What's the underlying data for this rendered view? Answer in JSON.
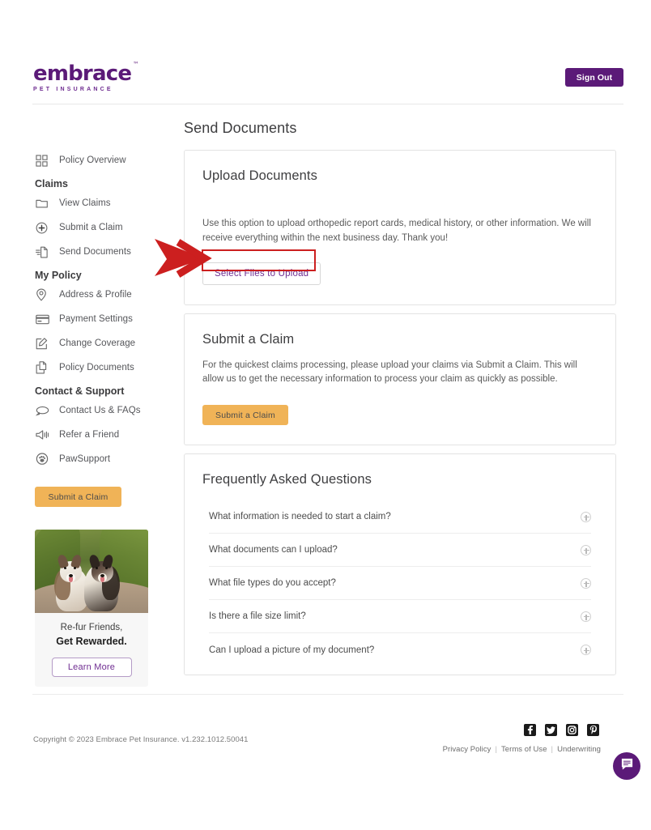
{
  "header": {
    "brand_word": "embrace",
    "brand_tm": "™",
    "brand_sub": "PET INSURANCE",
    "sign_out_label": "Sign Out"
  },
  "sidebar": {
    "items": [
      {
        "label": "Policy Overview",
        "icon": "grid-icon"
      },
      {
        "label": "View Claims",
        "icon": "folder-icon"
      },
      {
        "label": "Submit a Claim",
        "icon": "plus-circle-icon"
      },
      {
        "label": "Send Documents",
        "icon": "send-document-icon"
      },
      {
        "label": "Address & Profile",
        "icon": "map-pin-icon"
      },
      {
        "label": "Payment Settings",
        "icon": "credit-card-icon"
      },
      {
        "label": "Change Coverage",
        "icon": "edit-square-icon"
      },
      {
        "label": "Policy Documents",
        "icon": "copy-documents-icon"
      },
      {
        "label": "Contact Us & FAQs",
        "icon": "speech-bubble-icon"
      },
      {
        "label": "Refer a Friend",
        "icon": "megaphone-icon"
      },
      {
        "label": "PawSupport",
        "icon": "paw-badge-icon"
      }
    ],
    "groups": {
      "claims": "Claims",
      "my_policy": "My Policy",
      "contact_support": "Contact & Support"
    },
    "cta_label": "Submit a Claim",
    "promo": {
      "line1": "Re-fur Friends,",
      "line2": "Get Rewarded.",
      "button_label": "Learn More",
      "image_alt": "two-dogs-photo"
    }
  },
  "main": {
    "page_title": "Send Documents",
    "upload_card": {
      "title": "Upload Documents",
      "body": "Use this option to upload orthopedic report cards, medical history, or other information. We will receive everything within the next business day. Thank you!",
      "button_label": "Select Files to Upload"
    },
    "claim_card": {
      "title": "Submit a Claim",
      "body": "For the quickest claims processing, please upload your claims via Submit a Claim. This will allow us to get the necessary information to process your claim as quickly as possible.",
      "button_label": "Submit a Claim"
    },
    "faq_card": {
      "title": "Frequently Asked Questions",
      "items": [
        {
          "question": "What information is needed to start a claim?"
        },
        {
          "question": "What documents can I upload?"
        },
        {
          "question": "What file types do you accept?"
        },
        {
          "question": "Is there a file size limit?"
        },
        {
          "question": "Can I upload a picture of my document?"
        }
      ]
    }
  },
  "annotation": {
    "arrow_color": "#cc1f1f",
    "highlight_color": "#cc1f1f",
    "target": "Select Files to Upload"
  },
  "footer": {
    "copyright": "Copyright © 2023   Embrace Pet Insurance. v1.232.1012.50041",
    "social": [
      {
        "name": "facebook-icon"
      },
      {
        "name": "twitter-icon"
      },
      {
        "name": "instagram-icon"
      },
      {
        "name": "pinterest-icon"
      }
    ],
    "legal": [
      {
        "label": "Privacy Policy"
      },
      {
        "label": "Terms of Use"
      },
      {
        "label": "Underwriting"
      }
    ],
    "separator": "|"
  },
  "chat": {
    "icon": "chat-bubble-icon"
  },
  "colors": {
    "brand_purple": "#5b1a78",
    "accent_purple": "#6f2d91",
    "cta_orange": "#f0b357",
    "annotation_red": "#cc1f1f"
  }
}
